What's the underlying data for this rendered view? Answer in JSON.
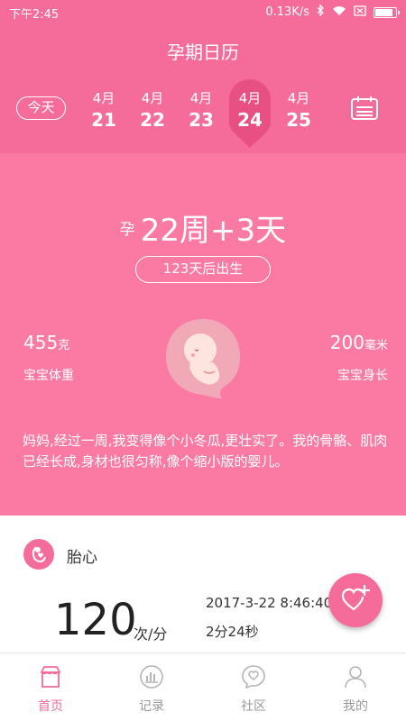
{
  "status_bar": {
    "time": "下午2:45",
    "speed": "0.13K/s"
  },
  "header": {
    "title": "孕期日历",
    "today_label": "今天",
    "dates": [
      {
        "month": "4月",
        "day": "21"
      },
      {
        "month": "4月",
        "day": "22"
      },
      {
        "month": "4月",
        "day": "23"
      },
      {
        "month": "4月",
        "day": "24",
        "selected": true
      },
      {
        "month": "4月",
        "day": "25"
      }
    ]
  },
  "pregnancy": {
    "prefix": "孕",
    "week_text": "22周+3天",
    "birth_countdown": "123天后出生",
    "weight_value": "455",
    "weight_unit": "克",
    "weight_label": "宝宝体重",
    "length_value": "200",
    "length_unit": "毫米",
    "length_label": "宝宝身长",
    "description": "妈妈,经过一周,我变得像个小冬瓜,更壮实了。我的骨骼、肌肉已经长成,身材也很匀称,像个缩小版的婴儿。"
  },
  "heartbeat": {
    "title": "胎心",
    "bpm": "120",
    "unit": "次/分",
    "record_time": "2017-3-22 8:46:40",
    "duration": "2分24秒"
  },
  "tabs": [
    {
      "label": "首页",
      "icon": "home-icon",
      "active": true
    },
    {
      "label": "记录",
      "icon": "record-icon"
    },
    {
      "label": "社区",
      "icon": "community-icon"
    },
    {
      "label": "我的",
      "icon": "profile-icon"
    }
  ],
  "colors": {
    "primary": "#f56b99",
    "main_bg": "#fb7aa4",
    "selected_pin": "#e84f82"
  }
}
